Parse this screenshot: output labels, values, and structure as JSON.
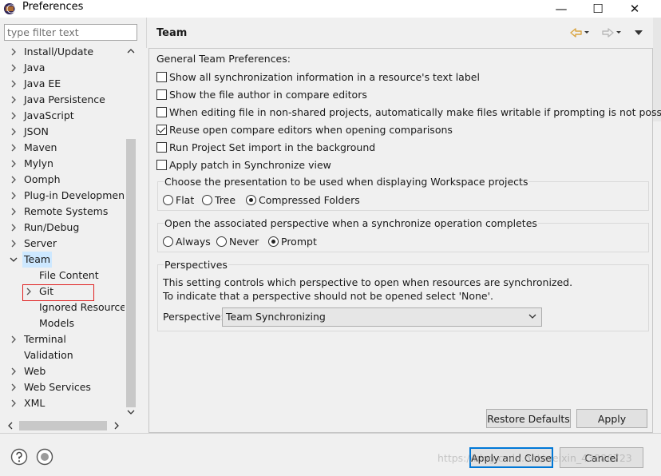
{
  "window": {
    "title": "Preferences",
    "minimize_glyph": "—",
    "maximize_glyph": "☐",
    "close_glyph": "✕"
  },
  "filter": {
    "placeholder": "type filter text"
  },
  "tree": {
    "items": [
      {
        "label": "Install/Update",
        "expander": "›",
        "level": 0
      },
      {
        "label": "Java",
        "expander": "›",
        "level": 0
      },
      {
        "label": "Java EE",
        "expander": "›",
        "level": 0
      },
      {
        "label": "Java Persistence",
        "expander": "›",
        "level": 0
      },
      {
        "label": "JavaScript",
        "expander": "›",
        "level": 0
      },
      {
        "label": "JSON",
        "expander": "›",
        "level": 0
      },
      {
        "label": "Maven",
        "expander": "›",
        "level": 0
      },
      {
        "label": "Mylyn",
        "expander": "›",
        "level": 0
      },
      {
        "label": "Oomph",
        "expander": "›",
        "level": 0
      },
      {
        "label": "Plug-in Development",
        "expander": "›",
        "level": 0
      },
      {
        "label": "Remote Systems",
        "expander": "›",
        "level": 0
      },
      {
        "label": "Run/Debug",
        "expander": "›",
        "level": 0
      },
      {
        "label": "Server",
        "expander": "›",
        "level": 0
      },
      {
        "label": "Team",
        "expander": "⌄",
        "level": 0,
        "selected": true
      },
      {
        "label": "File Content",
        "expander": "",
        "level": 1
      },
      {
        "label": "Git",
        "expander": "›",
        "level": 1,
        "highlighted": true
      },
      {
        "label": "Ignored Resource",
        "expander": "",
        "level": 1
      },
      {
        "label": "Models",
        "expander": "",
        "level": 1
      },
      {
        "label": "Terminal",
        "expander": "›",
        "level": 0
      },
      {
        "label": "Validation",
        "expander": "",
        "level": 0
      },
      {
        "label": "Web",
        "expander": "›",
        "level": 0
      },
      {
        "label": "Web Services",
        "expander": "›",
        "level": 0
      },
      {
        "label": "XML",
        "expander": "›",
        "level": 0
      }
    ]
  },
  "page": {
    "title": "Team",
    "general_label": "General Team Preferences:",
    "checkboxes": [
      {
        "label": "Show all synchronization information in a resource's text label",
        "checked": false
      },
      {
        "label": "Show the file author in compare editors",
        "checked": false
      },
      {
        "label": "When editing file in non-shared projects, automatically make files writable if prompting is not possible",
        "checked": false
      },
      {
        "label": "Reuse open compare editors when opening comparisons",
        "checked": true
      },
      {
        "label": "Run Project Set import in the background",
        "checked": false
      },
      {
        "label": "Apply patch in Synchronize view",
        "checked": false
      }
    ],
    "presentation_group": {
      "label": "Choose the presentation to be used when displaying Workspace projects",
      "options": [
        {
          "label": "Flat",
          "checked": false
        },
        {
          "label": "Tree",
          "checked": false
        },
        {
          "label": "Compressed Folders",
          "checked": true
        }
      ]
    },
    "perspective_switch_group": {
      "label": "Open the associated perspective when a synchronize operation completes",
      "options": [
        {
          "label": "Always",
          "checked": false
        },
        {
          "label": "Never",
          "checked": false
        },
        {
          "label": "Prompt",
          "checked": true
        }
      ]
    },
    "perspectives_group": {
      "label": "Perspectives",
      "line1": "This setting controls which perspective to open when resources are synchronized.",
      "line2": "To indicate that a perspective should not be opened select 'None'.",
      "field_label": "Perspective:",
      "field_value": "Team Synchronizing"
    },
    "restore_defaults_label": "Restore Defaults",
    "apply_label": "Apply"
  },
  "footer": {
    "apply_close_label": "Apply and Close",
    "cancel_label": "Cancel",
    "watermark": "https://blog.csdn.net/weixin_43886723"
  },
  "colors": {
    "selection": "#cde8ff",
    "highlight_box": "#e02020",
    "default_button_border": "#0078d7",
    "nav_arrow": "#d9a441"
  },
  "icons": [
    "eclipse-app-icon",
    "back-arrow-icon",
    "forward-arrow-icon",
    "view-menu-icon",
    "help-icon",
    "import-export-icon",
    "chevron-down-icon"
  ]
}
